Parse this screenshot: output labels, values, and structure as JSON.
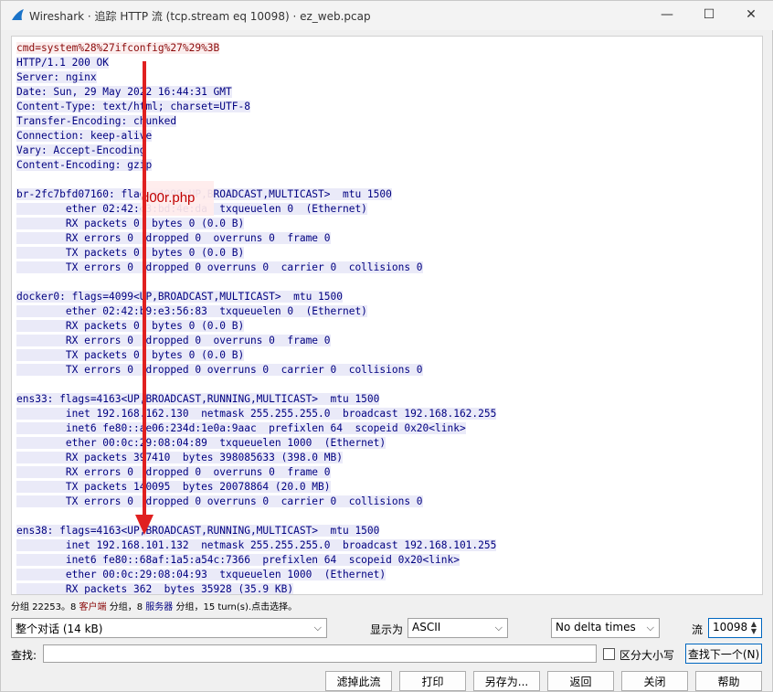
{
  "window": {
    "title": "Wireshark · 追踪 HTTP 流 (tcp.stream eq 10098) · ez_web.pcap",
    "minimize": "—",
    "maximize": "☐",
    "close": "✕",
    "app_icon": "wireshark-fin-icon"
  },
  "stream_lines": [
    {
      "dir": "cli",
      "text": "cmd=system%28%27ifconfig%27%29%3B"
    },
    {
      "dir": "srv",
      "text": "HTTP/1.1 200 OK"
    },
    {
      "dir": "srv",
      "text": "Server: nginx"
    },
    {
      "dir": "srv",
      "text": "Date: Sun, 29 May 2022 16:44:31 GMT"
    },
    {
      "dir": "srv",
      "text": "Content-Type: text/html; charset=UTF-8"
    },
    {
      "dir": "srv",
      "text": "Transfer-Encoding: chunked"
    },
    {
      "dir": "srv",
      "text": "Connection: keep-alive"
    },
    {
      "dir": "srv",
      "text": "Vary: Accept-Encoding"
    },
    {
      "dir": "srv",
      "text": "Content-Encoding: gzip"
    },
    {
      "dir": "blank",
      "text": ""
    },
    {
      "dir": "srv",
      "text": "br-2fc7bfd07160: flags=4099<UP,BROADCAST,MULTICAST>  mtu 1500"
    },
    {
      "dir": "srv",
      "text": "        ether 02:42:c3:bd:4e:da  txqueuelen 0  (Ethernet)"
    },
    {
      "dir": "srv",
      "text": "        RX packets 0  bytes 0 (0.0 B)"
    },
    {
      "dir": "srv",
      "text": "        RX errors 0  dropped 0  overruns 0  frame 0"
    },
    {
      "dir": "srv",
      "text": "        TX packets 0  bytes 0 (0.0 B)"
    },
    {
      "dir": "srv",
      "text": "        TX errors 0  dropped 0 overruns 0  carrier 0  collisions 0"
    },
    {
      "dir": "blank",
      "text": ""
    },
    {
      "dir": "srv",
      "text": "docker0: flags=4099<UP,BROADCAST,MULTICAST>  mtu 1500"
    },
    {
      "dir": "srv",
      "text": "        ether 02:42:b9:e3:56:83  txqueuelen 0  (Ethernet)"
    },
    {
      "dir": "srv",
      "text": "        RX packets 0  bytes 0 (0.0 B)"
    },
    {
      "dir": "srv",
      "text": "        RX errors 0  dropped 0  overruns 0  frame 0"
    },
    {
      "dir": "srv",
      "text": "        TX packets 0  bytes 0 (0.0 B)"
    },
    {
      "dir": "srv",
      "text": "        TX errors 0  dropped 0 overruns 0  carrier 0  collisions 0"
    },
    {
      "dir": "blank",
      "text": ""
    },
    {
      "dir": "srv",
      "text": "ens33: flags=4163<UP,BROADCAST,RUNNING,MULTICAST>  mtu 1500"
    },
    {
      "dir": "srv",
      "text": "        inet 192.168.162.130  netmask 255.255.255.0  broadcast 192.168.162.255"
    },
    {
      "dir": "srv",
      "text": "        inet6 fe80::ae06:234d:1e0a:9aac  prefixlen 64  scopeid 0x20<link>"
    },
    {
      "dir": "srv",
      "text": "        ether 00:0c:29:08:04:89  txqueuelen 1000  (Ethernet)"
    },
    {
      "dir": "srv",
      "text": "        RX packets 397410  bytes 398085633 (398.0 MB)"
    },
    {
      "dir": "srv",
      "text": "        RX errors 0  dropped 0  overruns 0  frame 0"
    },
    {
      "dir": "srv",
      "text": "        TX packets 140095  bytes 20078864 (20.0 MB)"
    },
    {
      "dir": "srv",
      "text": "        TX errors 0  dropped 0 overruns 0  carrier 0  collisions 0"
    },
    {
      "dir": "blank",
      "text": ""
    },
    {
      "dir": "srv",
      "text": "ens38: flags=4163<UP,BROADCAST,RUNNING,MULTICAST>  mtu 1500"
    },
    {
      "dir": "srv",
      "text": "        inet 192.168.101.132  netmask 255.255.255.0  broadcast 192.168.101.255"
    },
    {
      "dir": "srv",
      "text": "        inet6 fe80::68af:1a5:a54c:7366  prefixlen 64  scopeid 0x20<link>"
    },
    {
      "dir": "srv",
      "text": "        ether 00:0c:29:08:04:93  txqueuelen 1000  (Ethernet)"
    },
    {
      "dir": "srv",
      "text": "        RX packets 362  bytes 35928 (35.9 KB)"
    }
  ],
  "annotation": {
    "label": "d00r.php",
    "arrow_color": "#e02020"
  },
  "status": {
    "prefix": "分组 22253。",
    "client_count": "8 ",
    "client_label": "客户端",
    "mid1": " 分组，",
    "server_count": "8 ",
    "server_label": "服务器",
    "suffix": " 分组，15 turn(s).点击选择。"
  },
  "controls": {
    "conversation_select": "整个对话 (14 kB)",
    "show_as_label": "显示为",
    "show_as_select": "ASCII",
    "delta_select": "No delta times",
    "stream_label": "流",
    "stream_value": "10098",
    "find_label": "查找:",
    "find_value": "",
    "case_label": "区分大小写",
    "find_next": "查找下一个(N)"
  },
  "buttons": {
    "filter_out": "滤掉此流",
    "print": "打印",
    "save_as": "另存为...",
    "back": "返回",
    "close": "关闭",
    "help": "帮助"
  },
  "colors": {
    "client_text": "#8b0a0a",
    "client_bg": "#fbeded",
    "server_text": "#000080",
    "server_bg": "#eaeaf8"
  }
}
